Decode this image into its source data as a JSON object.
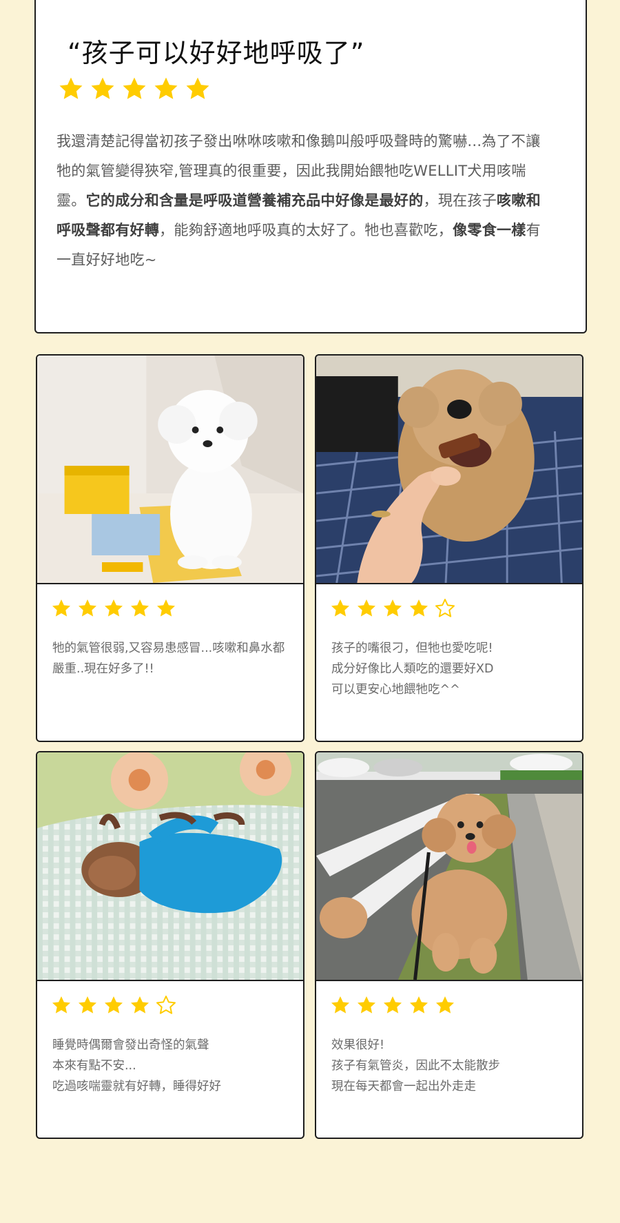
{
  "colors": {
    "background": "#fbf3d6",
    "star_filled": "#ffcc00",
    "star_outline": "#ffcc00",
    "border": "#1e1e1e"
  },
  "featured_review": {
    "title": "“孩子可以好好地呼吸了”",
    "rating": 5,
    "body": [
      {
        "text": "我還清楚記得當初孩子發出咻咻咳嗽和像鵝叫般呼吸聲時的驚嚇...為了不讓牠的氣管變得狹窄,管理真的很重要，因此我開始餵牠吃WELLIT犬用咳喘靈。",
        "bold": false
      },
      {
        "text": "它的成分和含量是呼吸道營養補充品中好像是最好的",
        "bold": true
      },
      {
        "text": "，現在孩子",
        "bold": false
      },
      {
        "text": "咳嗽和呼吸聲都有好轉",
        "bold": true
      },
      {
        "text": "，能夠舒適地呼吸真的太好了。牠也喜歡吃，",
        "bold": false
      },
      {
        "text": "像零食一樣",
        "bold": true
      },
      {
        "text": "有一直好好地吃~",
        "bold": false
      }
    ]
  },
  "reviews": [
    {
      "photo": "white-poodle-with-product-boxes",
      "rating": 5,
      "lines": [
        "牠的氣管很弱,又容易患感冒...咳嗽和鼻水都",
        "嚴重..現在好多了!!"
      ]
    },
    {
      "photo": "poodle-eating-treat-from-hand",
      "rating": 4,
      "lines": [
        "孩子的嘴很刁，但牠也愛吃呢!",
        "成分好像比人類吃的還要好XD",
        "可以更安心地餵牠吃^^"
      ]
    },
    {
      "photo": "dog-sleeping-in-blue-sweater",
      "rating": 4,
      "lines": [
        "睡覺時偶爾會發出奇怪的氣聲",
        "本來有點不安...",
        "吃過咳喘靈就有好轉，睡得好好"
      ]
    },
    {
      "photo": "poodle-sitting-on-grass-outdoors",
      "rating": 5,
      "lines": [
        "效果很好!",
        "孩子有氣管炎，因此不太能散步",
        "現在每天都會一起出外走走"
      ]
    }
  ]
}
